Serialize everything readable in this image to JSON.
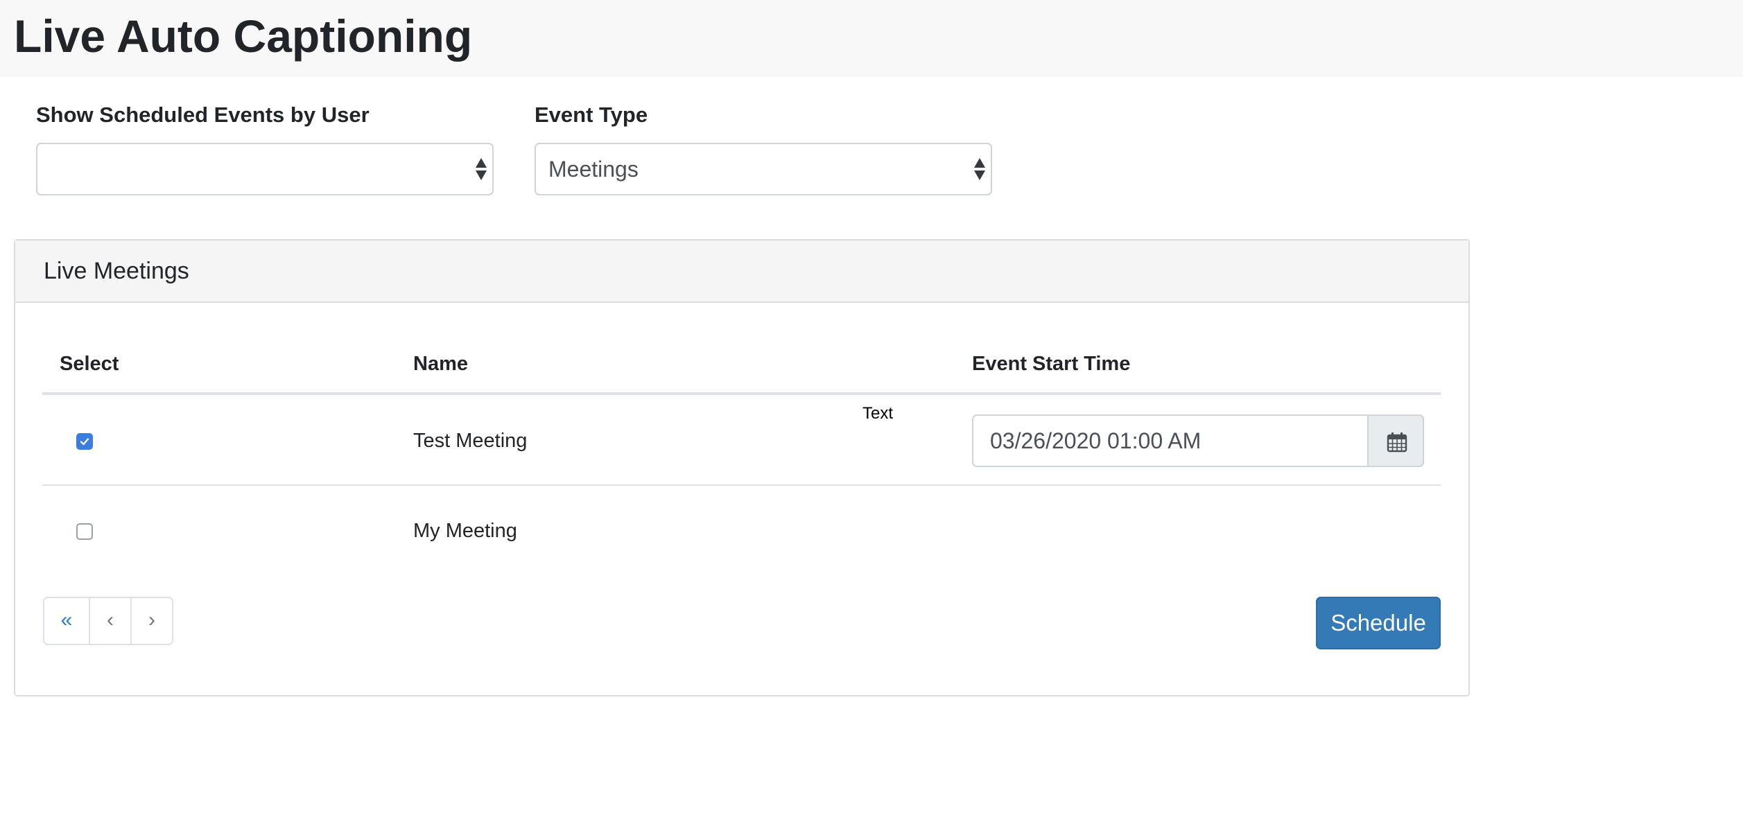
{
  "page": {
    "title": "Live Auto Captioning"
  },
  "filters": {
    "user": {
      "label": "Show Scheduled Events by User",
      "selected": ""
    },
    "event_type": {
      "label": "Event Type",
      "selected": "Meetings"
    }
  },
  "panel": {
    "title": "Live Meetings",
    "columns": {
      "select": "Select",
      "name": "Name",
      "start_time": "Event Start Time"
    },
    "rows": [
      {
        "name": "Test Meeting",
        "checked": true,
        "start_time": "03/26/2020 01:00 AM",
        "note": "Text"
      },
      {
        "name": "My Meeting",
        "checked": false
      }
    ],
    "pager": {
      "first": "«",
      "prev": "‹",
      "next": "›"
    },
    "schedule_label": "Schedule"
  },
  "icons": {
    "calendar": "calendar-icon",
    "checkmark": "checkmark-icon",
    "select_arrows": "sort-arrows-icon"
  },
  "colors": {
    "primary": "#337ab7",
    "checkbox_checked": "#3b7ddd",
    "pager_active": "#2f7bd0"
  }
}
